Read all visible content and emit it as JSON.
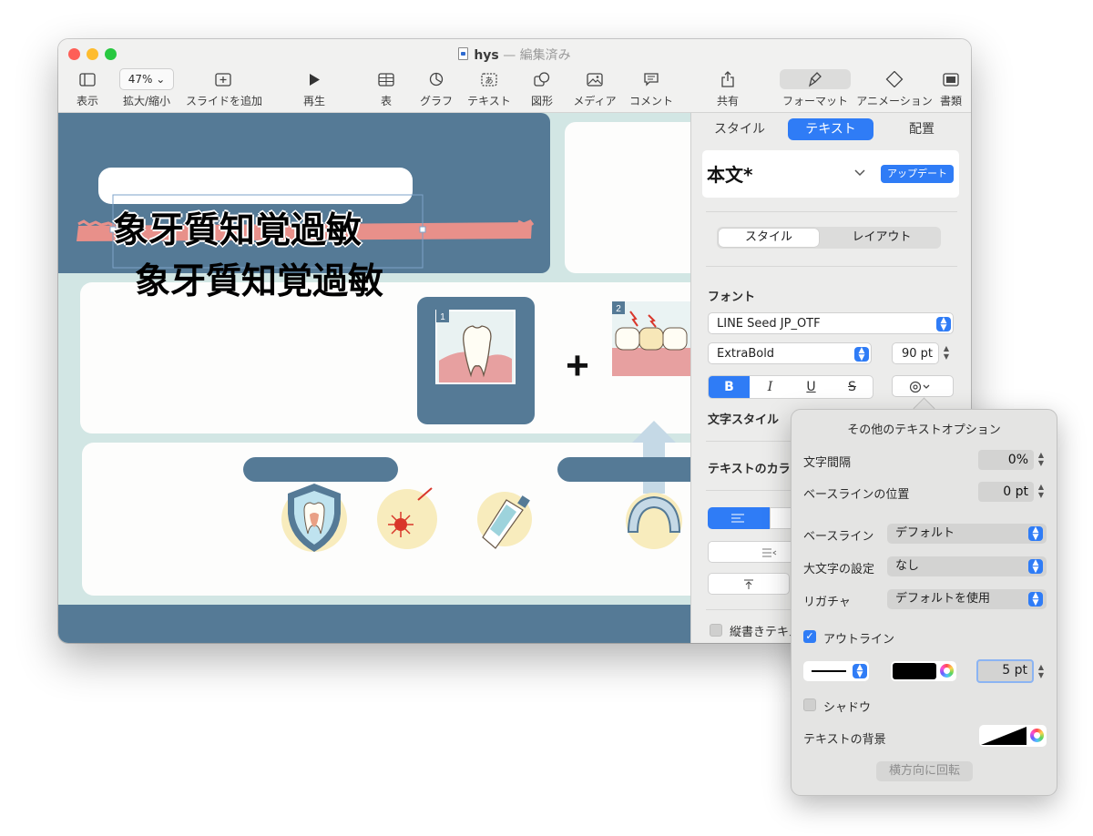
{
  "window": {
    "doc_name": "hys",
    "doc_separator": "—",
    "doc_status": "編集済み"
  },
  "toolbar": {
    "view": "表示",
    "zoom_value": "47% ⌄",
    "zoom": "拡大/縮小",
    "add_slide": "スライドを追加",
    "play": "再生",
    "table": "表",
    "chart": "グラフ",
    "text": "テキスト",
    "shape": "図形",
    "media": "メディア",
    "comment": "コメント",
    "share": "共有",
    "format": "フォーマット",
    "animate": "アニメーション",
    "document": "書類"
  },
  "slide": {
    "title_text": "象牙質知覚過敏",
    "subtitle_text": "象牙質知覚過敏",
    "badge_1": "1",
    "badge_2": "2",
    "plus": "+"
  },
  "inspector": {
    "tabs": [
      "スタイル",
      "テキスト",
      "配置"
    ],
    "active_tab": "テキスト",
    "paragraph_style": "本文*",
    "update_button": "アップデート",
    "segments": [
      "スタイル",
      "レイアウト"
    ],
    "font_heading": "フォント",
    "font_family": "LINE Seed JP_OTF",
    "font_weight": "ExtraBold",
    "font_size": "90 pt",
    "bold": "B",
    "italic": "I",
    "underline": "U",
    "strike": "S",
    "char_style_label": "文字スタイル",
    "text_color_label": "テキストのカラー",
    "vertical_text_label": "縦書きテキスト"
  },
  "popover": {
    "title": "その他のテキストオプション",
    "char_spacing_label": "文字間隔",
    "char_spacing_value": "0%",
    "baseline_shift_label": "ベースラインの位置",
    "baseline_shift_value": "0 pt",
    "baseline_label": "ベースライン",
    "baseline_value": "デフォルト",
    "capitalization_label": "大文字の設定",
    "capitalization_value": "なし",
    "ligature_label": "リガチャ",
    "ligature_value": "デフォルトを使用",
    "outline_label": "アウトライン",
    "outline_checked": true,
    "outline_width": "5 pt",
    "outline_color": "#000000",
    "shadow_label": "シャドウ",
    "shadow_checked": false,
    "background_label": "テキストの背景",
    "rotate_button": "横方向に回転"
  },
  "colors": {
    "accent": "#2f7cf6",
    "slide_dark": "#557a96",
    "slide_light": "#d2e6e4",
    "highlight": "#e8908a"
  }
}
